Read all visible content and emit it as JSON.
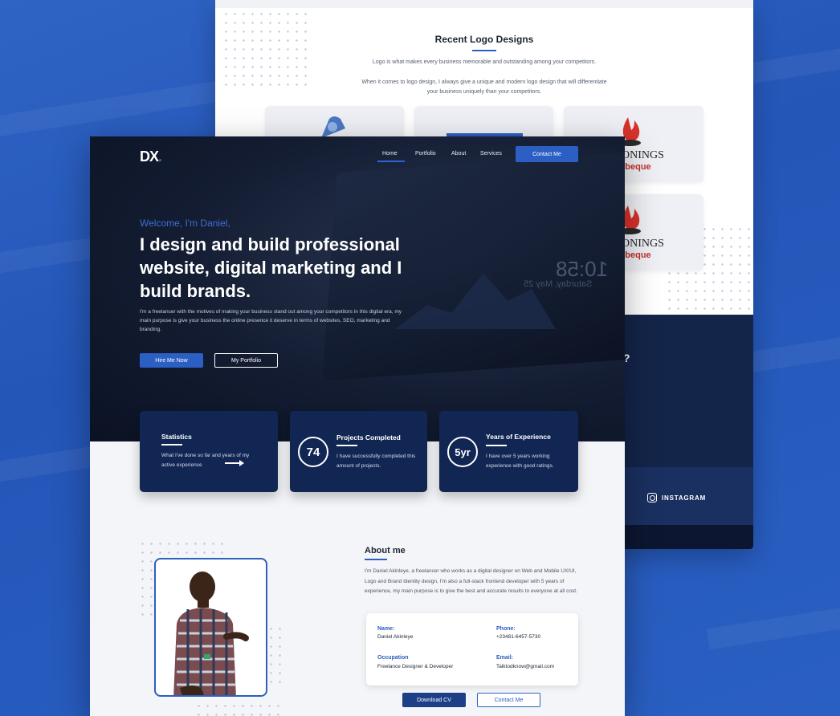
{
  "back_page": {
    "title": "Recent Logo Designs",
    "line1": "Logo is what makes every business memorable and outstanding among your competitors.",
    "line2": "When it comes to logo design, I always give a unique and modern logo design that will differentiate",
    "line3": "your business uniquely than your competitors.",
    "card_text_1a": "ONINGS",
    "card_text_1b": "rbeque",
    "card_text_2a": "ONINGS",
    "card_text_2b": "rbeque",
    "instagram_label": "INSTAGRAM",
    "question_mark": "?"
  },
  "nav": {
    "logo_text": "DX",
    "logo_dot": ".",
    "items": [
      "Home",
      "Portfolio",
      "About",
      "Services"
    ],
    "cta": "Contact Me"
  },
  "hero": {
    "welcome": "Welcome, I'm Daniel,",
    "headline": "I design and build professional website, digital marketing and I build brands.",
    "description": "I'm a freelancer with the motives of making your business stand out among your competitors in this digital era, my main purpose is give your business the online presence it deserve in terms of websites, SEO, marketing and branding.",
    "hire_button": "Hire Me Now",
    "portfolio_button": "My Portfolio",
    "clock_time": "10:58",
    "clock_date": "Saturday, May 25"
  },
  "stats": {
    "card1": {
      "title": "Statistics",
      "text": "What I've done so far and years of my active experience"
    },
    "card2": {
      "number": "74",
      "title": "Projects Completed",
      "text": "I have successfully completed this amount of projects."
    },
    "card3": {
      "number": "5yr",
      "title": "Years of Experience",
      "text": "I have over 5 years working experience with good ratings."
    }
  },
  "about": {
    "title": "About me",
    "text": "I'm Daniel Akinleye, a freelancer who works as a digital designer on Web and Mobile UX/UI, Logo and Brand Identity design, I'm also a full-stack frontend developer with 5 years of experience, my main purpose is to give the best and accurate results to everyone at all cost.",
    "name_label": "Name:",
    "name_value": "Daniel Akinleye",
    "phone_label": "Phone:",
    "phone_value": "+23481-6457-5730",
    "occupation_label": "Occupation",
    "occupation_value": "Freelance Designer & Developer",
    "email_label": "Email:",
    "email_value": "Talktodknow@gmail.com",
    "download_button": "Download CV",
    "contact_button": "Contact Me"
  },
  "colors": {
    "background": "#2a5fc2",
    "accent": "#2c5fc3",
    "dark_card": "#122654"
  }
}
